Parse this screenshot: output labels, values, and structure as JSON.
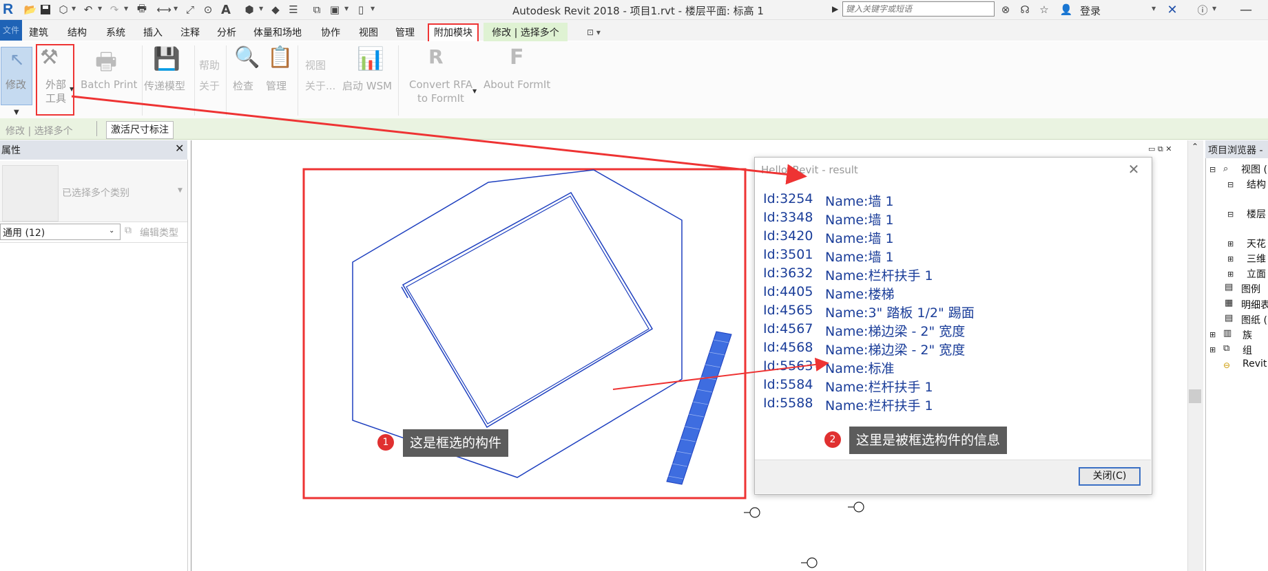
{
  "titlebar": {
    "app_title": "Autodesk Revit 2018 -    项目1.rvt - 楼层平面: 标高 1",
    "search_placeholder": "键入关键字或短语",
    "login": "登录"
  },
  "tabs": [
    "文件",
    "建筑",
    "结构",
    "系统",
    "插入",
    "注释",
    "分析",
    "体量和场地",
    "协作",
    "视图",
    "管理",
    "附加模块",
    "修改 | 选择多个"
  ],
  "ribbon": {
    "modify": "修改",
    "external_tools_1": "外部",
    "external_tools_2": "工具",
    "batch_print": "Batch Print",
    "transfer_model": "传递模型",
    "help_group": "帮助",
    "about": "关于",
    "check": "检查",
    "manage": "管理",
    "view_group": "视图",
    "about_more": "关于...",
    "start_wsm": "启动 WSM",
    "convert_rfa_1": "Convert RFA",
    "convert_rfa_2": "to FormIt",
    "about_formit": "About FormIt"
  },
  "optionsbar": {
    "context": "修改 | 选择多个",
    "activate_dims": "激活尺寸标注"
  },
  "properties": {
    "title": "属性",
    "type_label": "已选择多个类别",
    "filter_value": "通用 (12)",
    "edit_type": "编辑类型"
  },
  "project_browser": {
    "title": "项目浏览器 - ",
    "items": [
      "视图 (",
      "结构",
      "楼层",
      "天花",
      "三维",
      "立面",
      "图例",
      "明细表",
      "图纸 (",
      "族",
      "组",
      "Revit"
    ]
  },
  "dialog": {
    "title": "Hello_Revit - result",
    "rows": [
      {
        "id": "Id:3254",
        "name": "Name:墙 1"
      },
      {
        "id": "Id:3348",
        "name": "Name:墙 1"
      },
      {
        "id": "Id:3420",
        "name": "Name:墙 1"
      },
      {
        "id": "Id:3501",
        "name": "Name:墙 1"
      },
      {
        "id": "Id:3632",
        "name": "Name:栏杆扶手 1"
      },
      {
        "id": "Id:4405",
        "name": "Name:楼梯"
      },
      {
        "id": "Id:4565",
        "name": "Name:3\" 踏板 1/2\" 踢面"
      },
      {
        "id": "Id:4567",
        "name": "Name:梯边梁 - 2\" 宽度"
      },
      {
        "id": "Id:4568",
        "name": "Name:梯边梁 - 2\" 宽度"
      },
      {
        "id": "Id:5563",
        "name": "Name:标准"
      },
      {
        "id": "Id:5584",
        "name": "Name:栏杆扶手 1"
      },
      {
        "id": "Id:5588",
        "name": "Name:栏杆扶手 1"
      }
    ],
    "close_button": "关闭(C)"
  },
  "callouts": {
    "one_num": "1",
    "one_text": "这是框选的构件",
    "two_num": "2",
    "two_text": "这里是被框选构件的信息"
  },
  "colors": {
    "annotation_red": "#e33333",
    "element_blue": "#1d3fbf",
    "dialog_text_blue": "#1a3d99",
    "context_tab_green": "#dff2d3"
  }
}
